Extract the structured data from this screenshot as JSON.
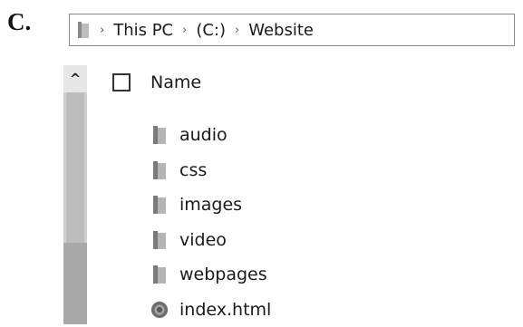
{
  "option_label": "C.",
  "address_bar": {
    "breadcrumbs": [
      "This PC",
      "(C:)",
      "Website"
    ],
    "separator": "›"
  },
  "scrollbar": {
    "up_arrow": "^"
  },
  "list_header": {
    "name_column": "Name"
  },
  "items": [
    {
      "label": "audio",
      "icon": "folder-icon"
    },
    {
      "label": "css",
      "icon": "folder-icon"
    },
    {
      "label": "images",
      "icon": "folder-icon"
    },
    {
      "label": "video",
      "icon": "folder-icon"
    },
    {
      "label": "webpages",
      "icon": "folder-icon"
    },
    {
      "label": "index.html",
      "icon": "html-file-icon"
    }
  ],
  "colors": {
    "folder": "#9a9a9a",
    "border": "#8a8a8a",
    "scroll_track": "#cfcfcf"
  }
}
